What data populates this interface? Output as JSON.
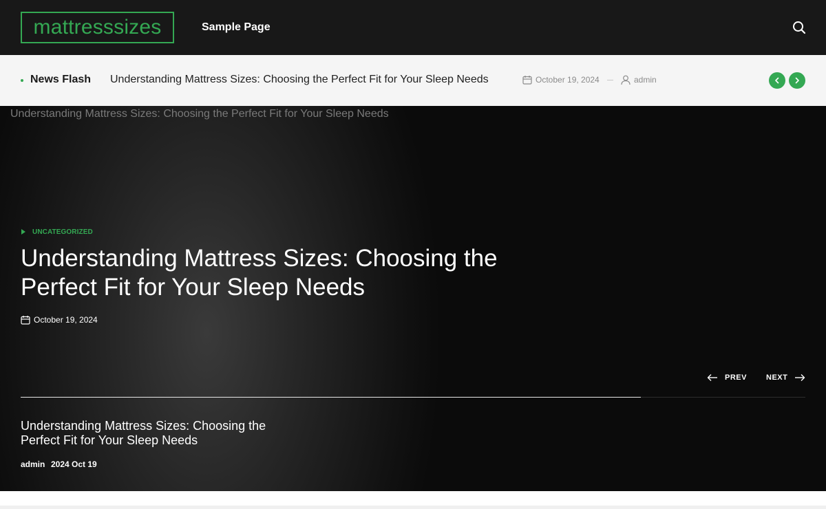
{
  "header": {
    "logo": "mattresssizes",
    "nav_items": [
      {
        "label": "Sample Page"
      }
    ]
  },
  "ticker": {
    "label": "News Flash",
    "title": "Understanding Mattress Sizes: Choosing the Perfect Fit for Your Sleep Needs",
    "date": "October 19, 2024",
    "author": "admin"
  },
  "hero": {
    "ghost_title": "Understanding Mattress Sizes: Choosing the Perfect Fit for Your Sleep Needs",
    "category": "UNCATEGORIZED",
    "title": "Understanding Mattress Sizes: Choosing the Perfect Fit for Your Sleep Needs",
    "date": "October 19, 2024",
    "prev_label": "PREV",
    "next_label": "NEXT",
    "slide": {
      "title": "Understanding Mattress Sizes: Choosing the Perfect Fit for Your Sleep Needs",
      "author": "admin",
      "date": "2024 Oct 19"
    },
    "progress": 0.79
  },
  "colors": {
    "accent": "#34a853",
    "header_bg": "#181818",
    "ticker_bg": "#f5f5f5",
    "hero_bg": "#111111"
  },
  "icons": {
    "search": "search-icon",
    "calendar": "calendar-icon",
    "user": "user-icon",
    "prev_arrow": "chevron-left-icon",
    "next_arrow": "chevron-right-icon",
    "prev_long": "arrow-left-icon",
    "next_long": "arrow-right-icon",
    "category": "triangle-right-icon"
  }
}
